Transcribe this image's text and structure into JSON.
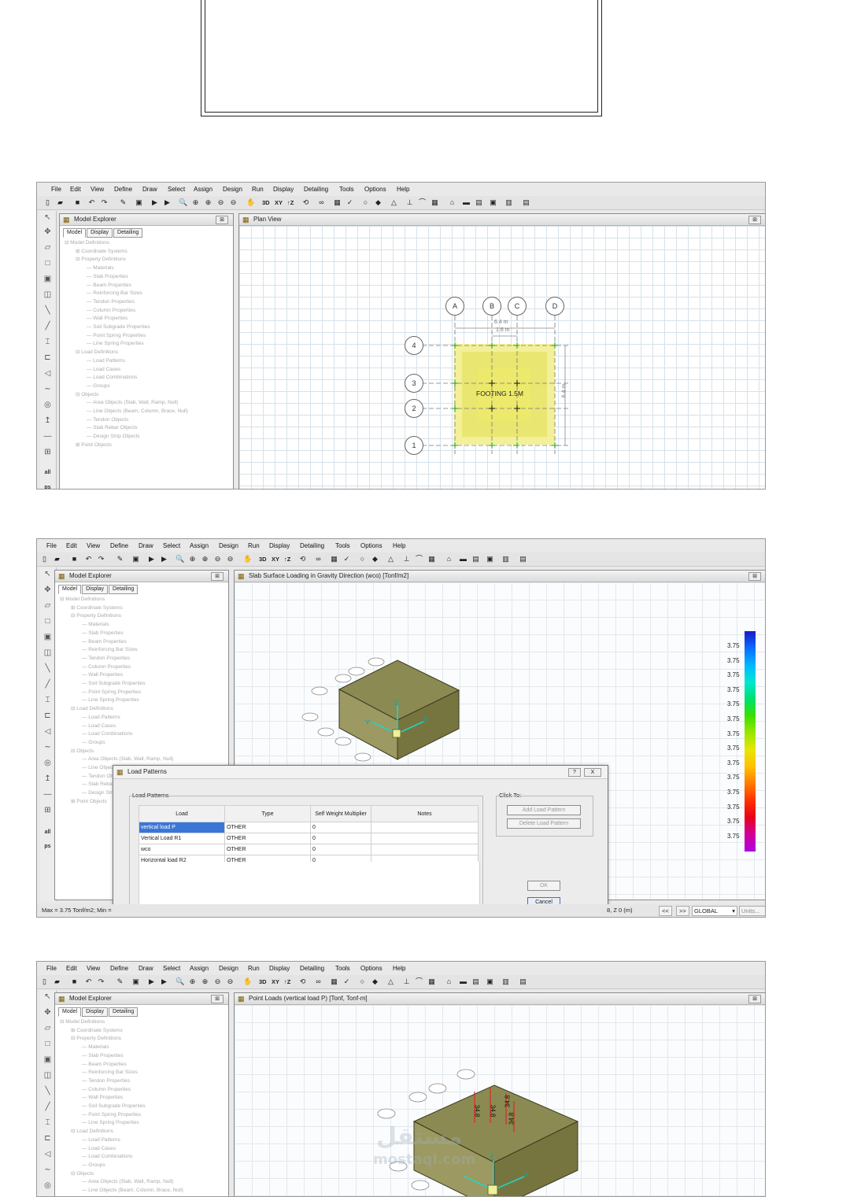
{
  "menu": [
    "File",
    "Edit",
    "View",
    "Define",
    "Draw",
    "Select",
    "Assign",
    "Design",
    "Run",
    "Display",
    "Detailing",
    "Tools",
    "Options",
    "Help"
  ],
  "toolbar_text": {
    "view3d": "3D",
    "viewxy": "XY",
    "viewz": "↑Z"
  },
  "explorer": {
    "title": "Model Explorer",
    "tabs": [
      "Model",
      "Display",
      "Detailing"
    ],
    "tree": [
      "⊟ Model Definitions",
      "⊞ Coordinate Systems",
      "⊟ Property Definitions",
      "— Materials",
      "— Slab Properties",
      "— Beam Properties",
      "— Reinforcing Bar Sizes",
      "— Tendon Properties",
      "— Column Properties",
      "— Wall Properties",
      "— Soil Subgrade Properties",
      "— Point Spring Properties",
      "— Line Spring Properties",
      "⊟ Load Definitions",
      "— Load Patterns",
      "— Load Cases",
      "— Load Combinations",
      "— Groups",
      "⊟ Objects",
      "— Area Objects (Slab, Wall, Ramp, Null)",
      "— Line Objects (Beam, Column, Brace, Null)",
      "— Tendon Objects",
      "— Slab Rebar Objects",
      "— Design Strip Objects",
      "⊞ Point Objects"
    ]
  },
  "side_labels": {
    "all": "all",
    "ps": "ps"
  },
  "shot1": {
    "view_title": "Plan View",
    "grid_x": [
      "A",
      "B",
      "C",
      "D"
    ],
    "grid_y": [
      "4",
      "3",
      "2",
      "1"
    ],
    "footing_label": "FOOTING 1.5M",
    "dims": [
      "6.4 m",
      "1.6 m",
      "6.4 m"
    ]
  },
  "shot2": {
    "view_title": "Slab Surface Loading in Gravity Direction (wco)  [Tonf/m2]",
    "legend_values": [
      "3.75",
      "3.75",
      "3.75",
      "3.75",
      "3.75",
      "3.75",
      "3.75",
      "3.75",
      "3.75",
      "3.75",
      "3.75",
      "3.75",
      "3.75",
      "3.75"
    ],
    "legend_colors": [
      "#1a1ac8",
      "#0a6bff",
      "#00b7ff",
      "#00e6d2",
      "#00e070",
      "#3ae000",
      "#9ae600",
      "#e6e600",
      "#ffc000",
      "#ff7a00",
      "#ff3000",
      "#e8001c",
      "#d0009a",
      "#b000e0"
    ],
    "status_left": "Max = 3.75 Tonf/m2;  Min =",
    "status_coord": "8, Z 0  (m)",
    "status_system": "GLOBAL",
    "status_units": "Units...",
    "nav_prev": "<<",
    "nav_next": ">>",
    "dialog": {
      "title": "Load Patterns",
      "help": "?",
      "close": "X",
      "group_label": "Load Patterns",
      "click_to": "Click To:",
      "headers": [
        "Load",
        "Type",
        "Self Weight Multiplier",
        "Notes"
      ],
      "rows": [
        {
          "load": "vertical load P",
          "type": "OTHER",
          "mult": "0"
        },
        {
          "load": "Vertical Load R1",
          "type": "OTHER",
          "mult": "0"
        },
        {
          "load": "wco",
          "type": "OTHER",
          "mult": "0"
        },
        {
          "load": "Horizontal  load R2",
          "type": "OTHER",
          "mult": "0"
        }
      ],
      "add_button": "Add Load Pattern",
      "delete_button": "Delete Load Pattern",
      "ok_button": "OK",
      "cancel_button": "Cancel"
    }
  },
  "shot3": {
    "view_title": "Point Loads (vertical load P)  [Tonf, Tonf-m]",
    "load_labels": [
      "34.8",
      "34.8",
      "34.8",
      "34.8"
    ],
    "watermark_ar": "مستقل",
    "watermark_en": "mostaql.com"
  },
  "colors": {
    "footing": "#f1ee8a",
    "slab3d": "#7f7a3a",
    "axis": "#22d3c5"
  }
}
